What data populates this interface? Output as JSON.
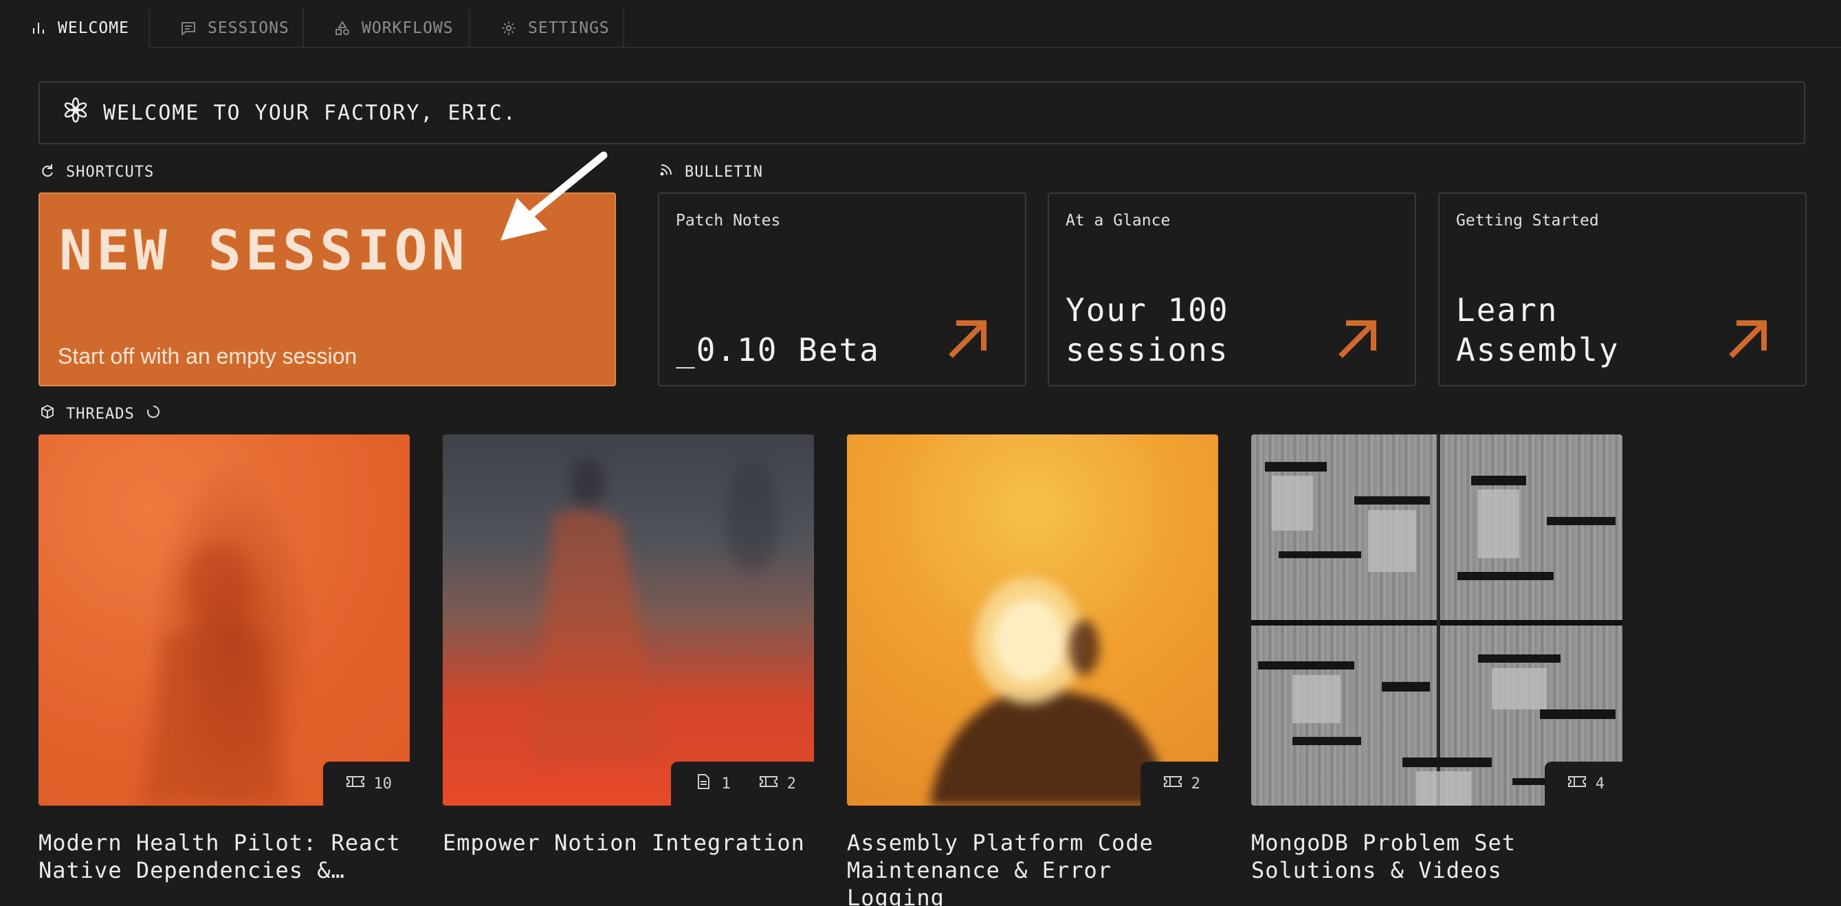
{
  "tabs": [
    {
      "label": "WELCOME",
      "icon": "bar-chart-icon",
      "active": true
    },
    {
      "label": "SESSIONS",
      "icon": "chat-icon",
      "active": false
    },
    {
      "label": "WORKFLOWS",
      "icon": "shapes-icon",
      "active": false
    },
    {
      "label": "SETTINGS",
      "icon": "gear-icon",
      "active": false
    }
  ],
  "banner": {
    "text": "WELCOME TO YOUR FACTORY, ERIC.",
    "icon": "asterisk-flower-icon"
  },
  "shortcuts": {
    "label": "SHORTCUTS",
    "new_session": {
      "title": "NEW SESSION",
      "subtitle": "Start off with an empty session"
    }
  },
  "bulletin": {
    "label": "BULLETIN",
    "cards": [
      {
        "kicker": "Patch Notes",
        "value": "_0.10 Beta"
      },
      {
        "kicker": "At a Glance",
        "value": "Your 100 sessions"
      },
      {
        "kicker": "Getting Started",
        "value": "Learn Assembly"
      }
    ]
  },
  "threads": {
    "label": "THREADS",
    "items": [
      {
        "title": "Modern Health Pilot: React Native Dependencies &…",
        "docs": null,
        "tickets": "10"
      },
      {
        "title": "Empower Notion Integration",
        "docs": "1",
        "tickets": "2"
      },
      {
        "title": "Assembly Platform Code Maintenance & Error Logging",
        "docs": null,
        "tickets": "2"
      },
      {
        "title": "MongoDB Problem Set Solutions & Videos",
        "docs": null,
        "tickets": "4"
      }
    ]
  },
  "colors": {
    "accent": "#d06a2c",
    "background": "#1c1c1c",
    "border": "#3a3a3a"
  }
}
